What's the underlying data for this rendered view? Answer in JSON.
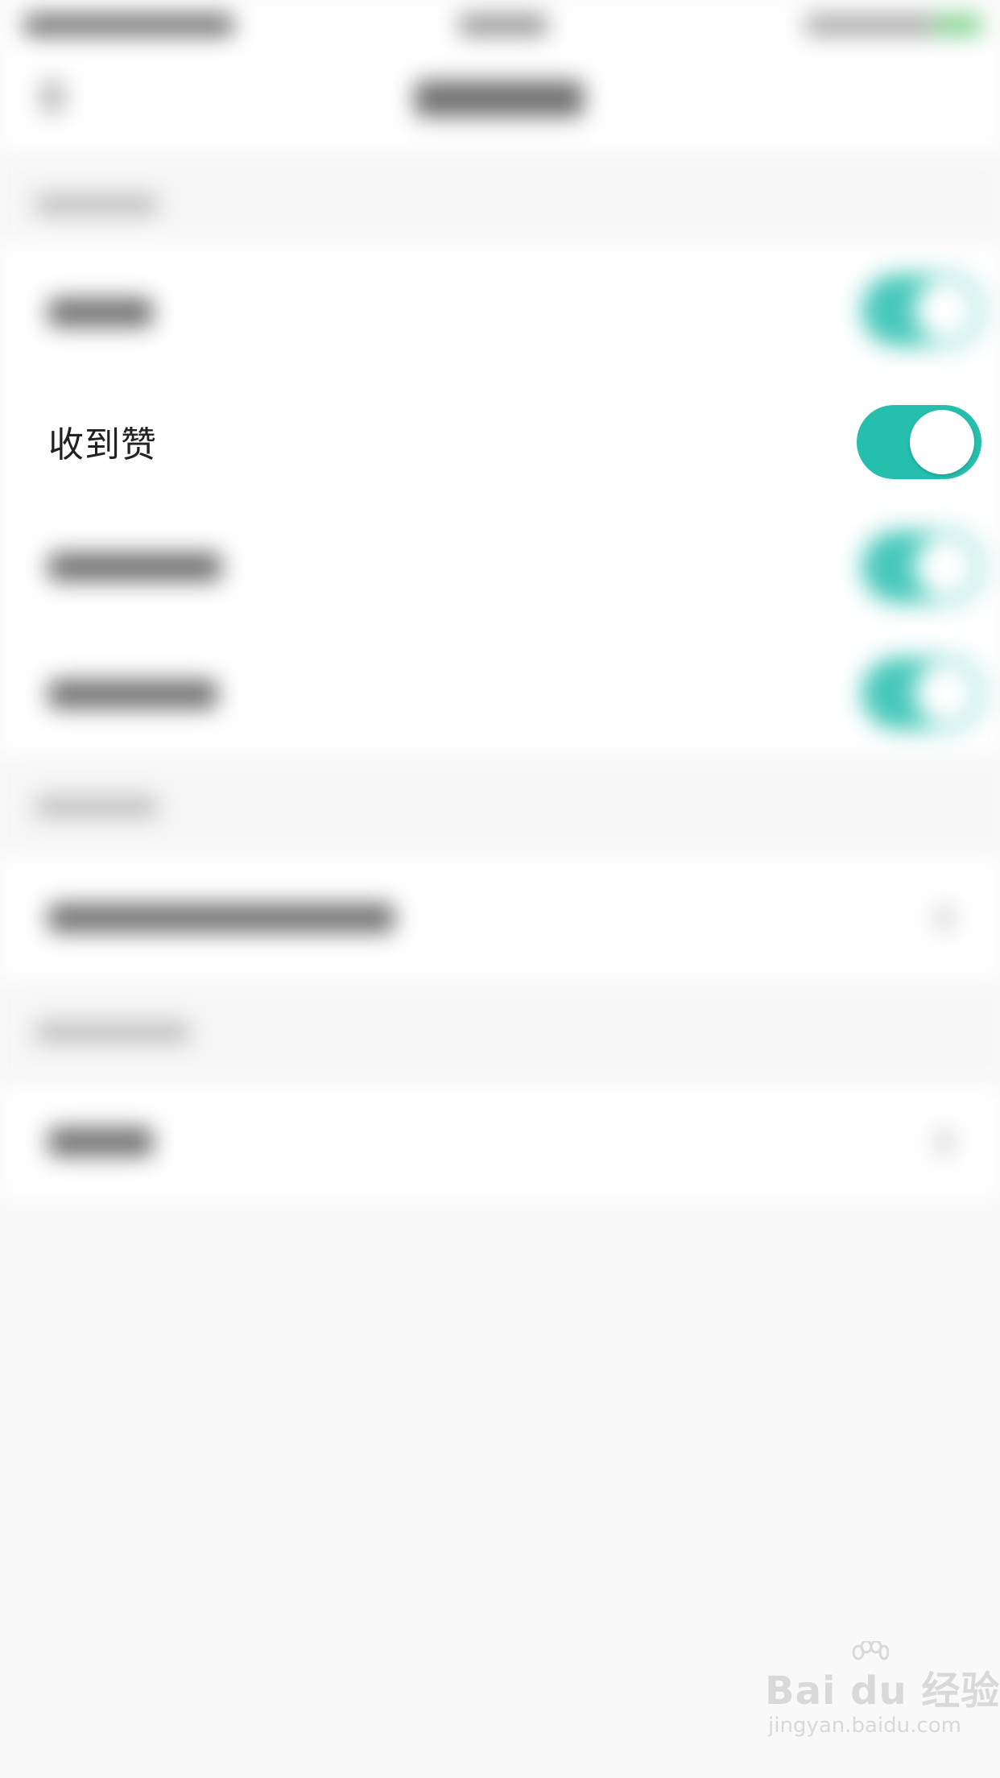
{
  "settings": {
    "focused_row": {
      "label": "收到赞",
      "toggle_on": true
    }
  },
  "colors": {
    "toggle_on": "#26bfae",
    "background": "#f9f9f9",
    "row_background": "#ffffff",
    "label_text": "#222222"
  },
  "watermark": {
    "brand": "Bai du 经验",
    "url": "jingyan.baidu.com"
  }
}
